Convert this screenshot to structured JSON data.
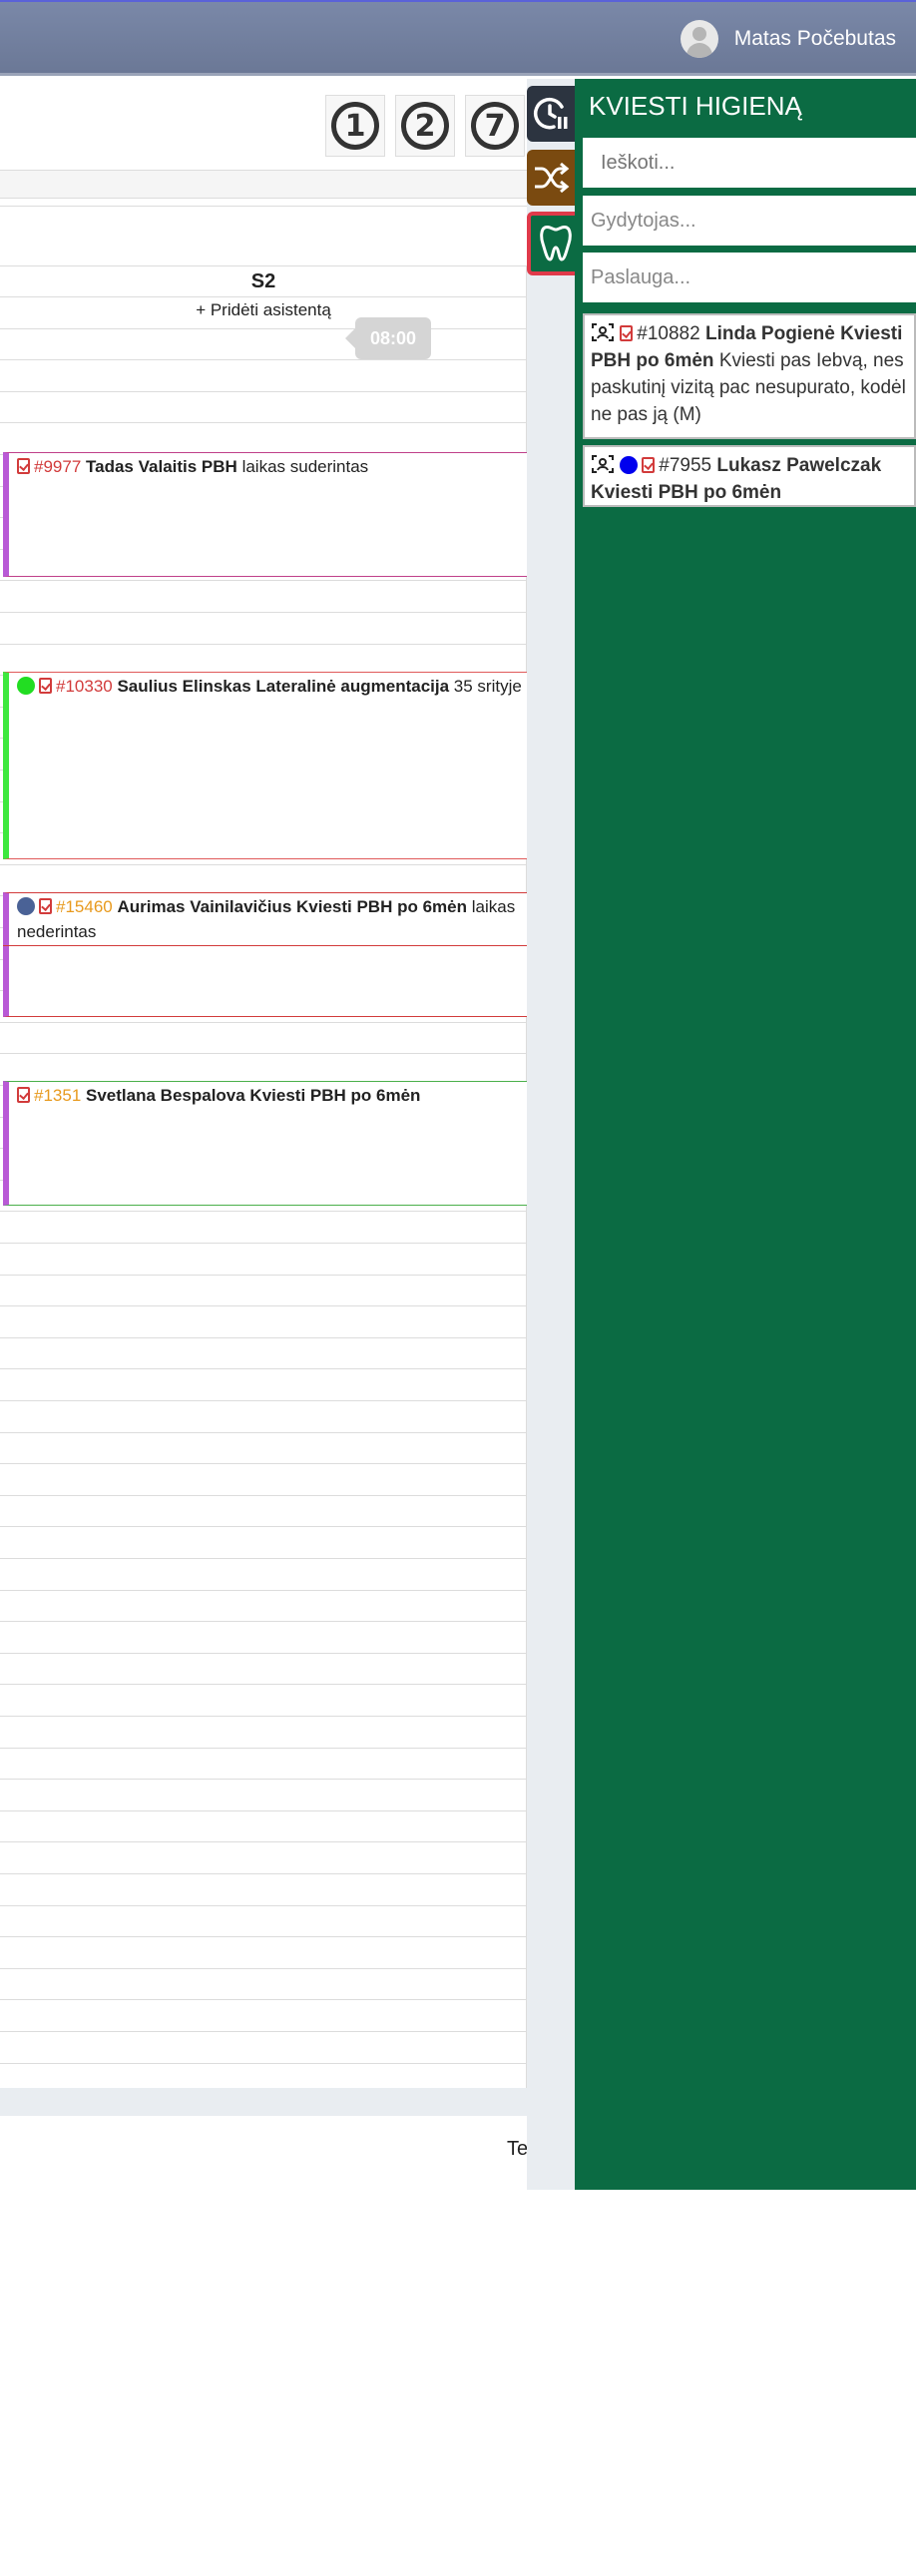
{
  "header": {
    "user_name": "Matas Počebutas"
  },
  "toolbar": {
    "numbers": [
      "1",
      "2",
      "7"
    ]
  },
  "calendar": {
    "column_name": "S2",
    "add_assistant": "+ Pridėti asistentą",
    "time_tooltip": "08:00",
    "appointments": [
      {
        "id": "#9977",
        "name": "Tadas Valaitis PBH",
        "note": "laikas suderintas",
        "id_color": "#d23b3b",
        "border": "#c0408a",
        "left": "#b95ad6",
        "status": ""
      },
      {
        "id": "#10330",
        "name": "Saulius Elinskas Lateralinė augmentacija",
        "note": "35 srityje",
        "id_color": "#d23b3b",
        "border": "#e05a5a",
        "left": "#3ee83e",
        "status": "#22dd22"
      },
      {
        "id": "#15460",
        "name": "Aurimas Vainilavičius Kviesti PBH po 6mėn",
        "note": "laikas nederintas",
        "id_color": "#e89a1e",
        "border": "#d23b3b",
        "left": "#b95ad6",
        "status": "#4a6296"
      },
      {
        "id": "#1351",
        "name": "Svetlana Bespalova Kviesti PBH po 6mėn",
        "note": "",
        "id_color": "#e89a1e",
        "border": "#4ab04a",
        "left": "#b95ad6",
        "status": ""
      }
    ]
  },
  "bottom": {
    "text": "Te"
  },
  "side_tabs": [
    {
      "icon": "clock-pause-icon",
      "color": "#2c3440"
    },
    {
      "icon": "shuffle-icon",
      "color": "#7a4a10"
    },
    {
      "icon": "tooth-icon",
      "color": "#0b6b43",
      "active": true
    }
  ],
  "panel": {
    "title": "KVIESTI HIGIENĄ",
    "search_placeholder": "Ieškoti...",
    "doctor_placeholder": "Gydytojas...",
    "service_placeholder": "Paslauga...",
    "cards": [
      {
        "id": "#10882",
        "name": "Linda Pogienė Kviesti PBH po 6mėn",
        "note": "Kviesti pas Iebvą, nes paskutinį vizitą pac nesupurato, kodėl ne pas ją (M)",
        "dot": ""
      },
      {
        "id": "#7955",
        "name": "Lukasz Pawelczak Kviesti PBH po 6mėn",
        "note": "",
        "dot": "#0000ee"
      }
    ]
  }
}
